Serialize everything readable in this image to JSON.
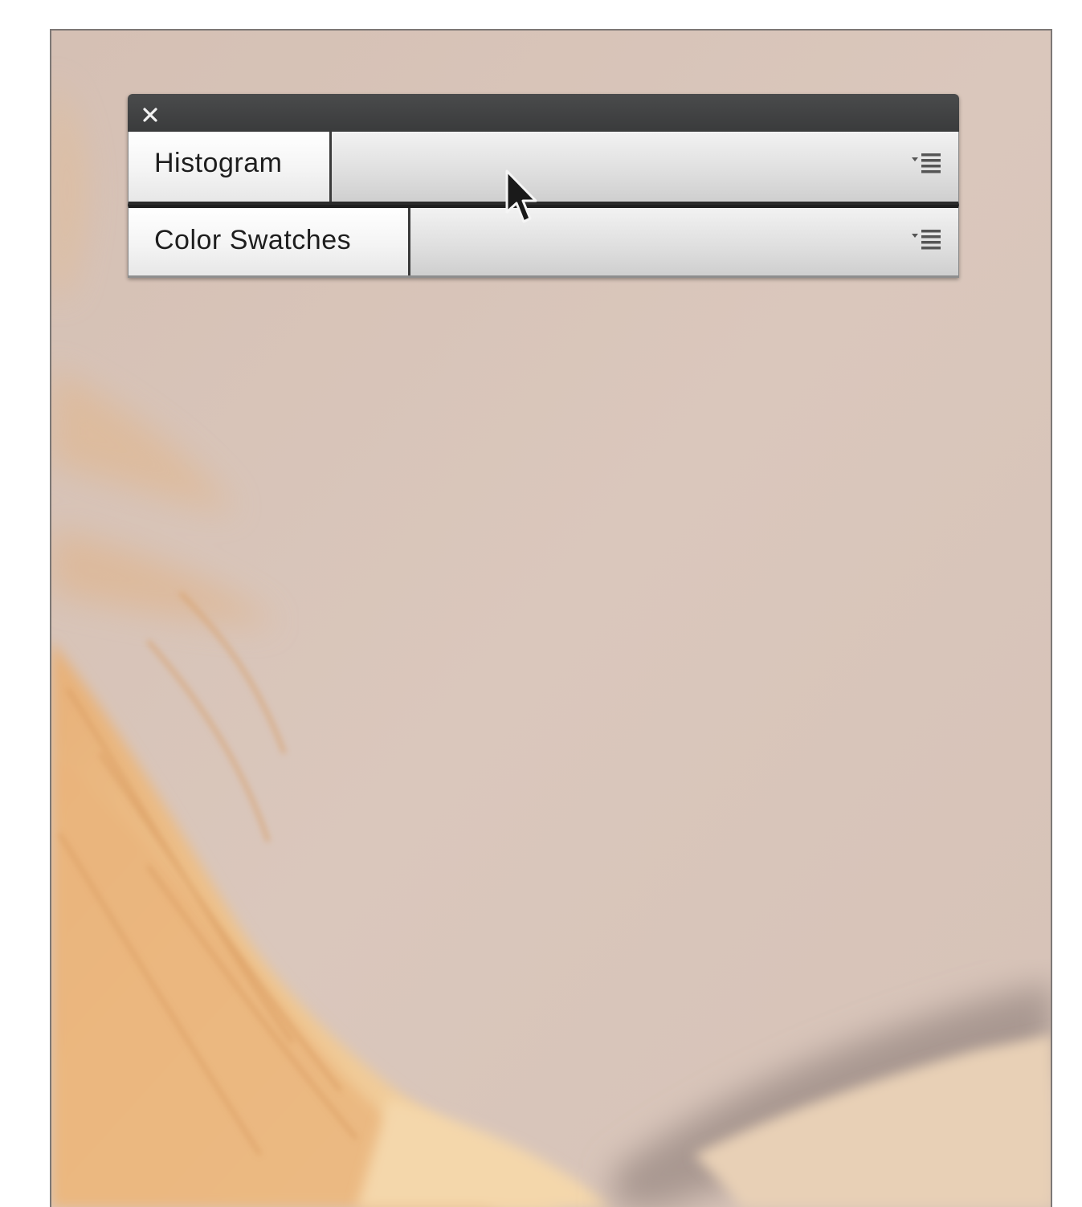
{
  "panel": {
    "close_icon": "close-icon",
    "tabs": [
      {
        "label": "Histogram",
        "menu_icon": "panel-menu-icon"
      },
      {
        "label": "Color Swatches",
        "menu_icon": "panel-menu-icon"
      }
    ]
  },
  "colors": {
    "canvas_background": "#d9c6bb",
    "titlebar": "#3f4041",
    "hair": "#e6b27c"
  }
}
